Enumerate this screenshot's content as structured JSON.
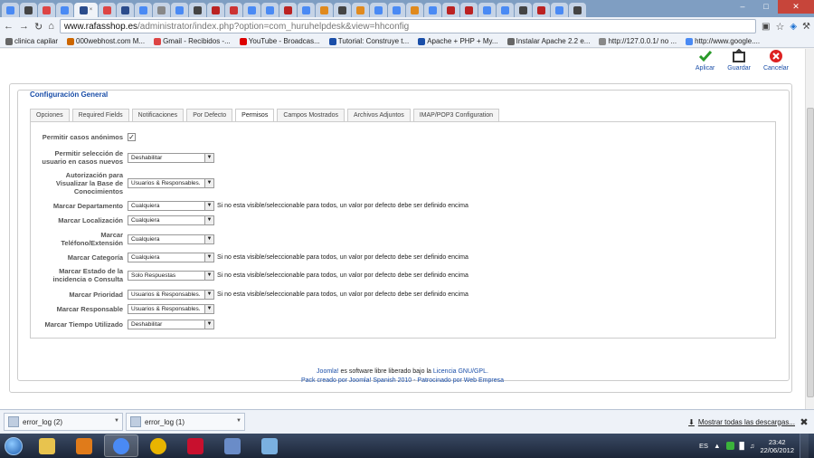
{
  "browser": {
    "tabs": [
      {
        "icon": "google-icon",
        "color": "#4a8af4"
      },
      {
        "icon": "x-icon",
        "color": "#444"
      },
      {
        "icon": "gmail-icon",
        "color": "#d44"
      },
      {
        "icon": "google-icon",
        "color": "#4a8af4"
      },
      {
        "icon": "page-icon",
        "color": "#2b4c8c",
        "active": true
      },
      {
        "icon": "gmail-icon",
        "color": "#d44"
      },
      {
        "icon": "page-icon",
        "color": "#2b4c8c"
      },
      {
        "icon": "google-icon",
        "color": "#4a8af4"
      },
      {
        "icon": "chrome-icon",
        "color": "#888"
      },
      {
        "icon": "google-icon",
        "color": "#4a8af4"
      },
      {
        "icon": "joomla-icon",
        "color": "#444"
      },
      {
        "icon": "joomla-icon",
        "color": "#b22"
      },
      {
        "icon": "page-icon",
        "color": "#c33"
      },
      {
        "icon": "page-icon",
        "color": "#4a8af4"
      },
      {
        "icon": "page-icon",
        "color": "#4a8af4"
      },
      {
        "icon": "page-icon",
        "color": "#b22"
      },
      {
        "icon": "page-icon",
        "color": "#4a8af4"
      },
      {
        "icon": "page-icon",
        "color": "#e08a1e"
      },
      {
        "icon": "page-icon",
        "color": "#444"
      },
      {
        "icon": "page-icon",
        "color": "#e08a1e"
      },
      {
        "icon": "page-icon",
        "color": "#4a8af4"
      },
      {
        "icon": "page-icon",
        "color": "#4a8af4"
      },
      {
        "icon": "page-icon",
        "color": "#e08a1e"
      },
      {
        "icon": "page-icon",
        "color": "#4a8af4"
      },
      {
        "icon": "page-icon",
        "color": "#b22"
      },
      {
        "icon": "page-icon",
        "color": "#b22"
      },
      {
        "icon": "page-icon",
        "color": "#4a8af4"
      },
      {
        "icon": "page-icon",
        "color": "#4a8af4"
      },
      {
        "icon": "page-icon",
        "color": "#444"
      },
      {
        "icon": "page-icon",
        "color": "#b22"
      },
      {
        "icon": "page-icon",
        "color": "#4a8af4"
      },
      {
        "icon": "page-icon",
        "color": "#444"
      }
    ],
    "url_host": "www.rafasshop.es",
    "url_path": "/administrator/index.php?option=com_huruhelpdesk&view=hhconfig",
    "bookmarks": [
      {
        "label": "clinica capilar",
        "color": "#666"
      },
      {
        "label": "000webhost.com M...",
        "color": "#c60"
      },
      {
        "label": "Gmail - Recibidos -...",
        "color": "#d44"
      },
      {
        "label": "YouTube - Broadcas...",
        "color": "#d00"
      },
      {
        "label": "Tutorial: Construye t...",
        "color": "#1a4ea8"
      },
      {
        "label": "Apache + PHP + My...",
        "color": "#1a4ea8"
      },
      {
        "label": "Instalar Apache 2.2 e...",
        "color": "#666"
      },
      {
        "label": "http://127.0.0.1/ no ...",
        "color": "#888"
      },
      {
        "label": "http://www.google....",
        "color": "#4a8af4"
      }
    ]
  },
  "toolbar_actions": [
    {
      "label": "Aplicar",
      "icon": "check-icon",
      "color": "#2a9a2a"
    },
    {
      "label": "Guardar",
      "icon": "save-icon",
      "color": "#333"
    },
    {
      "label": "Cancelar",
      "icon": "cancel-icon",
      "color": "#d22"
    }
  ],
  "config": {
    "legend": "Configuración General",
    "tabs": [
      "Opciones",
      "Required Fields",
      "Notificaciones",
      "Por Defecto",
      "Permisos",
      "Campos Mostrados",
      "Archivos Adjuntos",
      "IMAP/POP3 Configuration"
    ],
    "active_tab": "Permisos",
    "rows": [
      {
        "label": "Permitir casos anónimos",
        "type": "checkbox",
        "checked": true
      },
      {
        "label": "Permitir selección de usuario en casos nuevos",
        "type": "select",
        "value": "Deshabilitar"
      },
      {
        "label": "Autorización para Visualizar la Base de Conocimientos",
        "type": "select",
        "value": "Usuarios & Responsables."
      },
      {
        "label": "Marcar Departamento",
        "type": "select",
        "value": "Cualquiera",
        "note": "Si no esta visible/seleccionable para todos, un valor por defecto debe ser definido encima"
      },
      {
        "label": "Marcar Localización",
        "type": "select",
        "value": "Cualquiera"
      },
      {
        "label": "Marcar Teléfono/Extensión",
        "type": "select",
        "value": "Cualquiera"
      },
      {
        "label": "Marcar Categoría",
        "type": "select",
        "value": "Cualquiera",
        "note": "Si no esta visible/seleccionable para todos, un valor por defecto debe ser definido encima"
      },
      {
        "label": "Marcar Estado de la incidencia o Consulta",
        "type": "select",
        "value": "Solo Respuestas",
        "note": "Si no esta visible/seleccionable para todos, un valor por defecto debe ser definido encima"
      },
      {
        "label": "Marcar Prioridad",
        "type": "select",
        "value": "Usuarios & Responsables.",
        "note": "Si no esta visible/seleccionable para todos, un valor por defecto debe ser definido encima"
      },
      {
        "label": "Marcar Responsable",
        "type": "select",
        "value": "Usuarios & Responsables."
      },
      {
        "label": "Marcar Tiempo Utilizado",
        "type": "select",
        "value": "Deshabilitar"
      }
    ]
  },
  "footer": {
    "joomla": "Joomla!",
    "line1_mid": " es software libre liberado bajo la ",
    "license": "Licencia GNU/GPL.",
    "line2": "Pack creado por Joomla! Spanish 2010 - Patrocinado por Web Empresa"
  },
  "downloads": {
    "items": [
      "error_log (2)",
      "error_log (1)"
    ],
    "show_all": "Mostrar todas las descargas..."
  },
  "taskbar": {
    "lang": "ES",
    "time": "23:42",
    "date": "22/06/2012",
    "apps": [
      {
        "icon": "folder-icon",
        "color": "#e8c34e"
      },
      {
        "icon": "media-player-icon",
        "color": "#e07b1a"
      },
      {
        "icon": "chrome-icon",
        "color": "#4a8af4",
        "active": true
      },
      {
        "icon": "norton-icon",
        "color": "#e8b400"
      },
      {
        "icon": "mcafee-icon",
        "color": "#c8102e"
      },
      {
        "icon": "network-icon",
        "color": "#6a8cc8"
      },
      {
        "icon": "picture-icon",
        "color": "#7ab0e0"
      }
    ]
  }
}
